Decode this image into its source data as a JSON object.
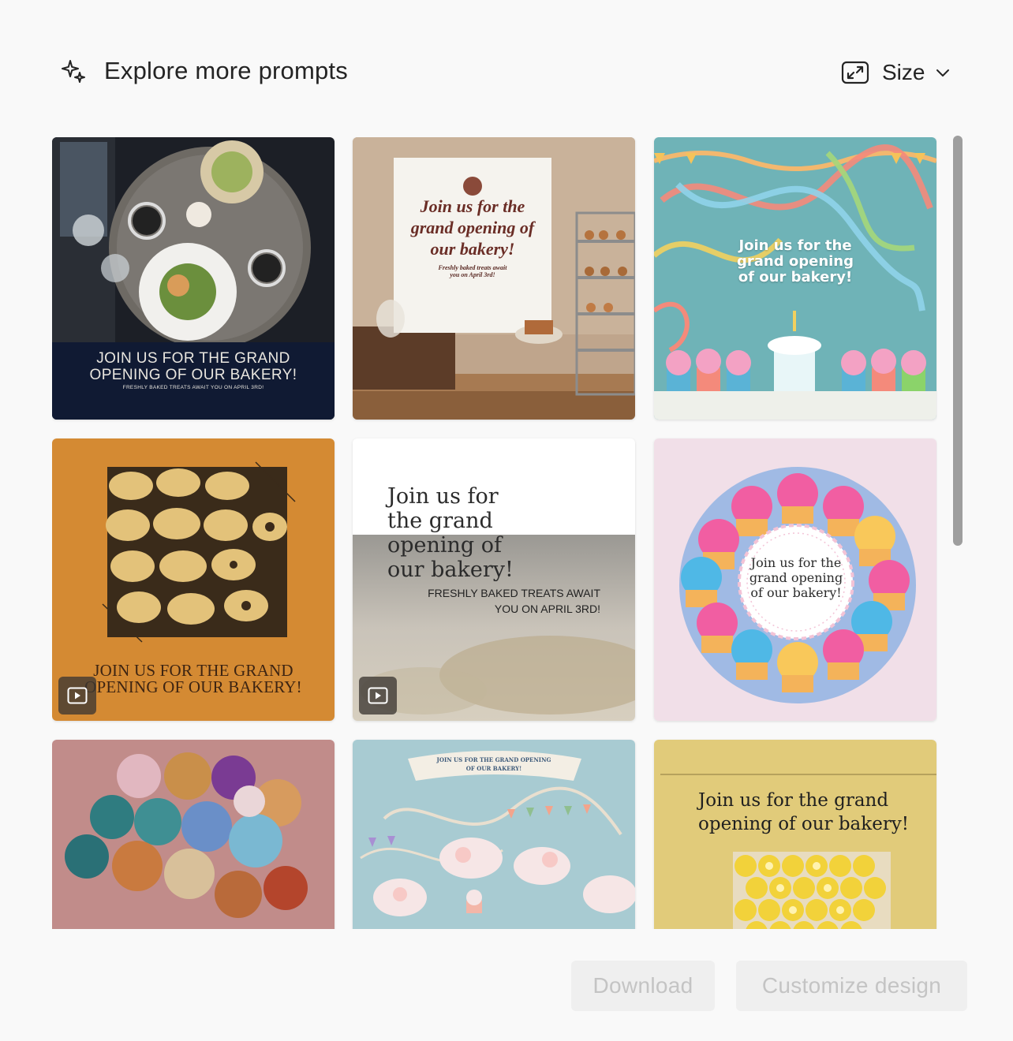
{
  "header": {
    "title": "Explore more prompts",
    "size_label": "Size",
    "title_icon": "sparkle-icon",
    "size_icon": "expand-icon"
  },
  "cards": [
    {
      "id": "dark-navy-overhead",
      "heading": "JOIN US FOR THE GRAND OPENING OF OUR BAKERY!",
      "heading_line1": "JOIN US FOR THE GRAND",
      "heading_line2": "OPENING OF OUR BAKERY!",
      "subtext": "FRESHLY BAKED TREATS AWAIT YOU ON APRIL 3RD!",
      "video": false
    },
    {
      "id": "bakery-shop-interior",
      "heading_line1": "Join us for the",
      "heading_line2": "grand opening of",
      "heading_line3": "our bakery!",
      "subtext_line1": "Freshly baked treats await",
      "subtext_line2": "you on April 3rd!",
      "video": false
    },
    {
      "id": "teal-ribbons-cupcakes",
      "heading_line1": "Join us for the",
      "heading_line2": "grand opening",
      "heading_line3": "of our bakery!",
      "video": false
    },
    {
      "id": "orange-pastries",
      "heading_line1": "JOIN US FOR THE GRAND",
      "heading_line2": "OPENING OF OUR BAKERY!",
      "video": true
    },
    {
      "id": "white-blur-pastry",
      "heading_line1": "Join us for",
      "heading_line2": "the grand",
      "heading_line3": "opening of",
      "heading_line4": "our bakery!",
      "subtext_line1": "FRESHLY BAKED TREATS AWAIT",
      "subtext_line2": "YOU ON APRIL 3RD!",
      "video": true
    },
    {
      "id": "cupcake-wreath",
      "heading_line1": "Join us for the",
      "heading_line2": "grand opening",
      "heading_line3": "of our bakery!",
      "video": false
    },
    {
      "id": "balloons",
      "video": false
    },
    {
      "id": "pastel-clouds",
      "banner_line1": "JOIN US FOR THE GRAND OPENING",
      "banner_line2": "OF OUR BAKERY!",
      "video": false
    },
    {
      "id": "yellow-lemon-tarts",
      "heading_line1": "Join us for the grand",
      "heading_line2": "opening of our bakery!",
      "video": false
    }
  ],
  "footer": {
    "download_label": "Download",
    "customize_label": "Customize design"
  },
  "colors": {
    "navy": "#101a33",
    "orange": "#d48a33",
    "teal": "#6fb3b7",
    "pink": "#f1dfe8",
    "mustard": "#e1cb7a",
    "button_bg": "#efefef",
    "button_text": "#c4c4c4"
  }
}
